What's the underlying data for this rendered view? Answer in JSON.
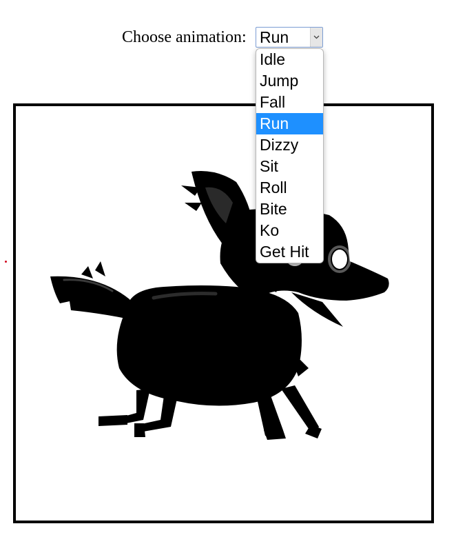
{
  "controls": {
    "label": "Choose animation:",
    "selected": "Run",
    "options": [
      "Idle",
      "Jump",
      "Fall",
      "Run",
      "Dizzy",
      "Sit",
      "Roll",
      "Bite",
      "Ko",
      "Get Hit"
    ],
    "selected_index": 3
  },
  "stage": {
    "character": "wolf-silhouette",
    "frame_border_color": "#000000",
    "eye_color": "#ffffff"
  },
  "colors": {
    "highlight": "#1e90ff",
    "select_border": "#7a9cd3",
    "marker": "#d0021b"
  },
  "icons": {
    "select_arrow": "chevron-down-icon"
  }
}
